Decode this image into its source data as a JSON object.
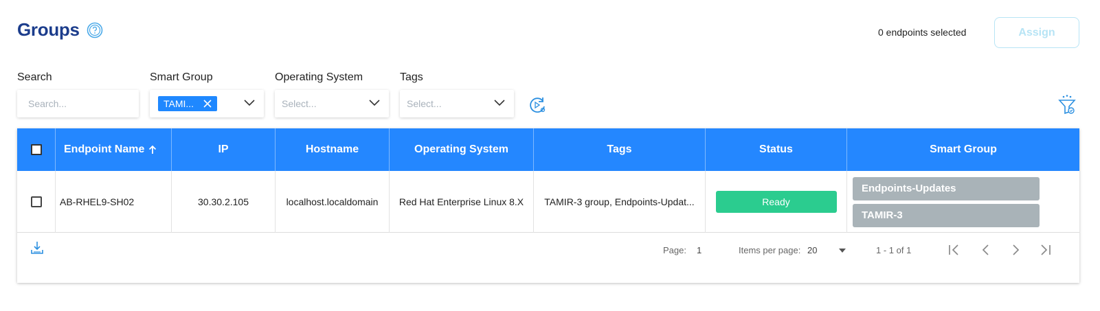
{
  "header": {
    "title": "Groups",
    "help_icon": "help-circle-icon",
    "selected_count_text": "0 endpoints selected",
    "assign_label": "Assign"
  },
  "filters": {
    "search": {
      "label": "Search",
      "placeholder": "Search..."
    },
    "smart_group": {
      "label": "Smart Group",
      "chip": "TAMI..."
    },
    "os": {
      "label": "Operating System",
      "placeholder": "Select..."
    },
    "tags": {
      "label": "Tags",
      "placeholder": "Select..."
    }
  },
  "table": {
    "columns": [
      "Endpoint Name",
      "IP",
      "Hostname",
      "Operating System",
      "Tags",
      "Status",
      "Smart Group"
    ],
    "sort": {
      "column": "Endpoint Name",
      "direction": "ascending"
    },
    "rows": [
      {
        "endpoint_name": "AB-RHEL9-SH02",
        "ip": "30.30.2.105",
        "hostname": "localhost.localdomain",
        "os": "Red Hat Enterprise Linux 8.X",
        "tags": "TAMIR-3 group, Endpoints-Updat...",
        "status": "Ready",
        "smart_groups": [
          "Endpoints-Updates",
          "TAMIR-3"
        ]
      }
    ]
  },
  "pagination": {
    "page_label": "Page:",
    "page_value": "1",
    "items_per_page_label": "Items per page:",
    "items_per_page_value": "20",
    "range_text": "1 - 1 of 1"
  },
  "colors": {
    "title": "#1c3d8c",
    "header_bg": "#2487ff",
    "chip": "#1f88ff",
    "status_ready": "#2bcc8f",
    "smart_group_tag": "#a9b3b8",
    "assign_disabled": "#b7e4f5"
  }
}
